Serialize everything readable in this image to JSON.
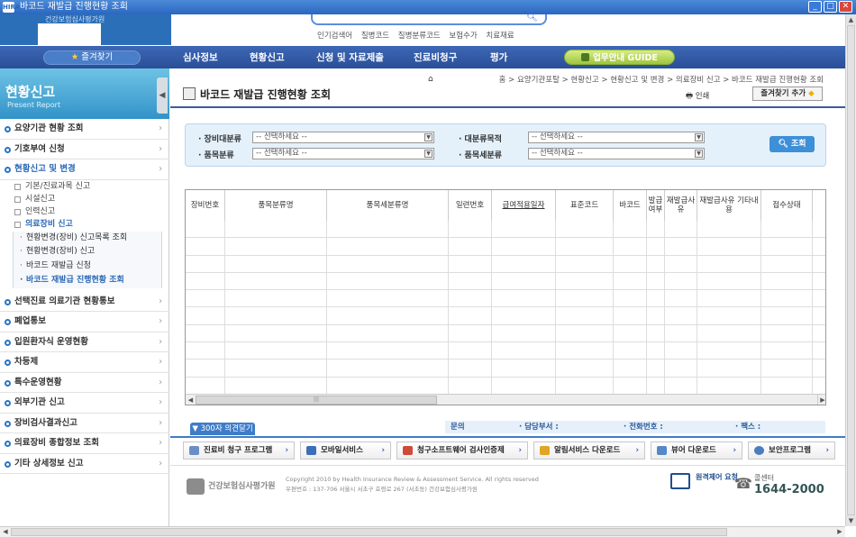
{
  "window": {
    "title": "바코드 재발급 진행현황 조회",
    "app_icon": "HIRA"
  },
  "header": {
    "logo_text": "건강보험심사평가원",
    "popular_label": "인기검색어",
    "popular_terms": [
      "질병코드",
      "질병분류코드",
      "보험수가",
      "치료재료"
    ]
  },
  "nav": {
    "favorites": "즐겨찾기",
    "items": [
      "심사정보",
      "현황신고",
      "신청 및 자료제출",
      "진료비청구",
      "평가"
    ],
    "guide": "업무안내 GUIDE"
  },
  "sidebar": {
    "title": "현황신고",
    "subtitle": "Present Report",
    "menu": [
      {
        "label": "요양기관 현황 조회"
      },
      {
        "label": "기호부여 신청"
      },
      {
        "label": "현황신고 및 변경"
      }
    ],
    "subs": [
      "기본/진료과목 신고",
      "시설신고",
      "인력신고",
      "의료장비 신고"
    ],
    "subsubs": [
      "현황변경(장비) 신고목록 조회",
      "현황변경(장비) 신고",
      "바코드 재발급 신청",
      "바코드 재발급 진행현황 조회"
    ],
    "menu2": [
      "선택진료 의료기관 현황통보",
      "폐업통보",
      "입원환자식 운영현황",
      "차등제",
      "특수운영현황",
      "외부기관 신고",
      "장비검사결과신고",
      "의료장비 종합정보 조회",
      "기타 상세정보 신고"
    ]
  },
  "content": {
    "breadcrumb": "홈 > 요양기관포탈 > 현황신고 > 현황신고 및 변경 > 의료장비 신고 > 바코드 재발급 진행현황 조회",
    "page_title": "바코드 재발급 진행현황 조회",
    "print": "인쇄",
    "add_fav": "즐겨찾기 추가",
    "search": {
      "label1": "· 장비대분류",
      "label2": "· 대분류목적",
      "label3": "· 품목분류",
      "label4": "· 품목세분류",
      "placeholder": "-- 선택하세요 --",
      "button": "조회"
    },
    "columns": [
      "장비번호",
      "품목분류명",
      "품목세분류명",
      "일련번호",
      "급여적용일자",
      "표준코드",
      "바코드",
      "발급여부",
      "재발급사유",
      "재발급사유 기타내용",
      "접수상태"
    ],
    "notice_tab": "300자 의견달기",
    "contact": {
      "inquiry": "문의",
      "dept": "· 담당부서 :",
      "phone": "· 전화번호 :",
      "fax": "· 팩스 :"
    },
    "services": [
      "진료비 청구 프로그램",
      "모바일서비스",
      "청구소프트웨어 검사인증제",
      "알림서비스 다운로드",
      "뷰어 다운로드",
      "보안프로그램"
    ],
    "footer": {
      "logo": "건강보험심사평가원",
      "copyright": "Copyright 2010 by Health Insurance Review & Assessment Service.  All rights reserved",
      "address": "우편번호 : 137-706  서울시 서초구 효령로 267 (서초동) 건강보험심사평가원",
      "remote": "원격제어 요청",
      "call_label": "콜센터",
      "call_number": "1644-2000"
    }
  }
}
